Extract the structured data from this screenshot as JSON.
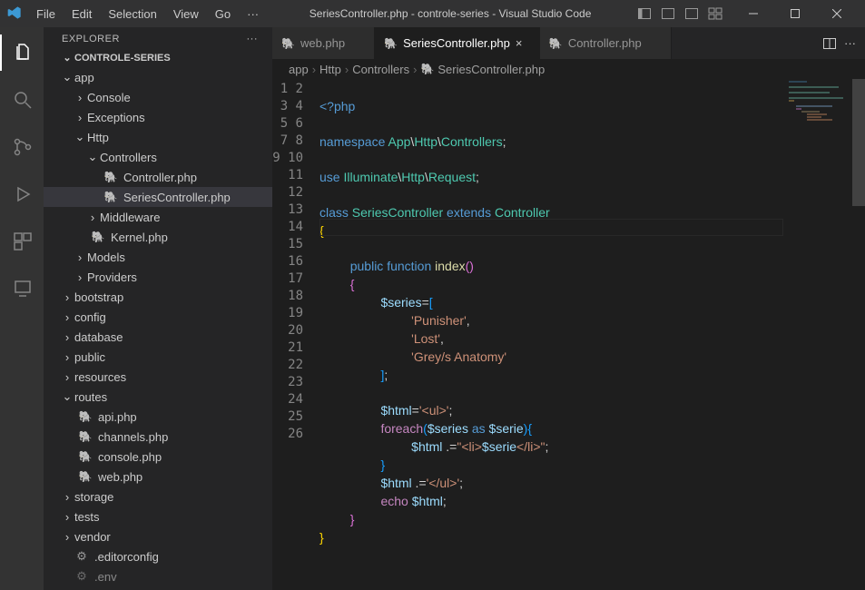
{
  "title": "SeriesController.php - controle-series - Visual Studio Code",
  "menu": [
    "File",
    "Edit",
    "Selection",
    "View",
    "Go"
  ],
  "sidebar_title": "EXPLORER",
  "project": "CONTROLE-SERIES",
  "tree": {
    "app": "app",
    "console": "Console",
    "exceptions": "Exceptions",
    "http": "Http",
    "controllers": "Controllers",
    "controllerphp": "Controller.php",
    "seriescontroller": "SeriesController.php",
    "middleware": "Middleware",
    "kernel": "Kernel.php",
    "models": "Models",
    "providers": "Providers",
    "bootstrap": "bootstrap",
    "config": "config",
    "database": "database",
    "public": "public",
    "resources": "resources",
    "routes": "routes",
    "api": "api.php",
    "channels": "channels.php",
    "consolephp": "console.php",
    "web": "web.php",
    "storage": "storage",
    "tests": "tests",
    "vendor": "vendor",
    "editorcfg": ".editorconfig",
    "env": ".env"
  },
  "tabs": {
    "t1": "web.php",
    "t2": "SeriesController.php",
    "t3": "Controller.php"
  },
  "crumbs": {
    "c1": "app",
    "c2": "Http",
    "c3": "Controllers",
    "c4": "SeriesController.php"
  },
  "code_lines": [
    1,
    2,
    3,
    4,
    5,
    6,
    7,
    8,
    9,
    10,
    11,
    12,
    13,
    14,
    15,
    16,
    17,
    18,
    19,
    20,
    21,
    22,
    23,
    24,
    25,
    26
  ],
  "code": {
    "l1_a": "<?",
    "l1_b": "php",
    "l3_a": "namespace ",
    "l3_b": "App",
    "l3_c": "\\",
    "l3_d": "Http",
    "l3_e": "\\",
    "l3_f": "Controllers",
    "l3_g": ";",
    "l5_a": "use ",
    "l5_b": "Illuminate",
    "l5_c": "\\",
    "l5_d": "Http",
    "l5_e": "\\",
    "l5_f": "Request",
    "l5_g": ";",
    "l7_a": "class ",
    "l7_b": "SeriesController",
    "l7_c": " extends ",
    "l7_d": "Controller",
    "l8": "{",
    "l10_a": "public",
    "l10_b": " function ",
    "l10_c": "index",
    "l10_d": "(",
    "l10_e": ")",
    "l11": "{",
    "l12_a": "$series",
    "l12_b": "=",
    "l12_c": "[",
    "l13": "'Punisher'",
    "l13_c": ",",
    "l14": "'Lost'",
    "l14_c": ",",
    "l15": "'Grey/s Anatomy'",
    "l16": "]",
    "l16_b": ";",
    "l18_a": "$html",
    "l18_b": "=",
    "l18_c": "'<ul>'",
    "l18_d": ";",
    "l19_a": "foreach",
    "l19_b": "(",
    "l19_c": "$series",
    "l19_d": " as ",
    "l19_e": "$serie",
    "l19_f": ")",
    "l19_g": "{",
    "l20_a": "$html",
    "l20_b": " .=",
    "l20_c": "\"<li>",
    "l20_d": "$serie",
    "l20_e": "</li>\"",
    "l20_f": ";",
    "l21": "}",
    "l22_a": "$html",
    "l22_b": " .=",
    "l22_c": "'</ul>'",
    "l22_d": ";",
    "l23_a": "echo ",
    "l23_b": "$html",
    "l23_c": ";",
    "l24": "}",
    "l25": "}"
  }
}
